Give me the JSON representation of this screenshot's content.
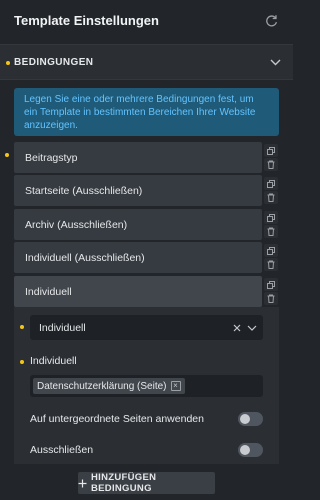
{
  "header": {
    "title": "Template Einstellungen",
    "refresh_icon": "refresh-icon"
  },
  "section": {
    "label": "BEDINGUNGEN",
    "chevron_icon": "chevron-down-icon"
  },
  "info": {
    "text": "Legen Sie eine oder mehrere Bedingungen fest, um ein Template in bestimmten Bereichen Ihrer Website anzuzeigen."
  },
  "conditions": [
    {
      "label": "Beitragstyp"
    },
    {
      "label": "Startseite (Ausschließen)"
    },
    {
      "label": "Archiv (Ausschließen)"
    },
    {
      "label": "Individuell (Ausschließen)"
    },
    {
      "label": "Individuell"
    }
  ],
  "editor": {
    "select_value": "Individuell",
    "field_label": "Individuell",
    "tag": "Datenschutzerklärung (Seite)",
    "toggle_children_label": "Auf untergeordnete Seiten anwenden",
    "toggle_children_on": false,
    "toggle_exclude_label": "Ausschließen",
    "toggle_exclude_on": false
  },
  "add_button": {
    "label": "HINZUFÜGEN BEDINGUNG"
  },
  "colors": {
    "background": "#22262b",
    "accent_dot": "#f5c518",
    "info_bg": "#1f5a78",
    "info_text": "#62c3ff"
  }
}
